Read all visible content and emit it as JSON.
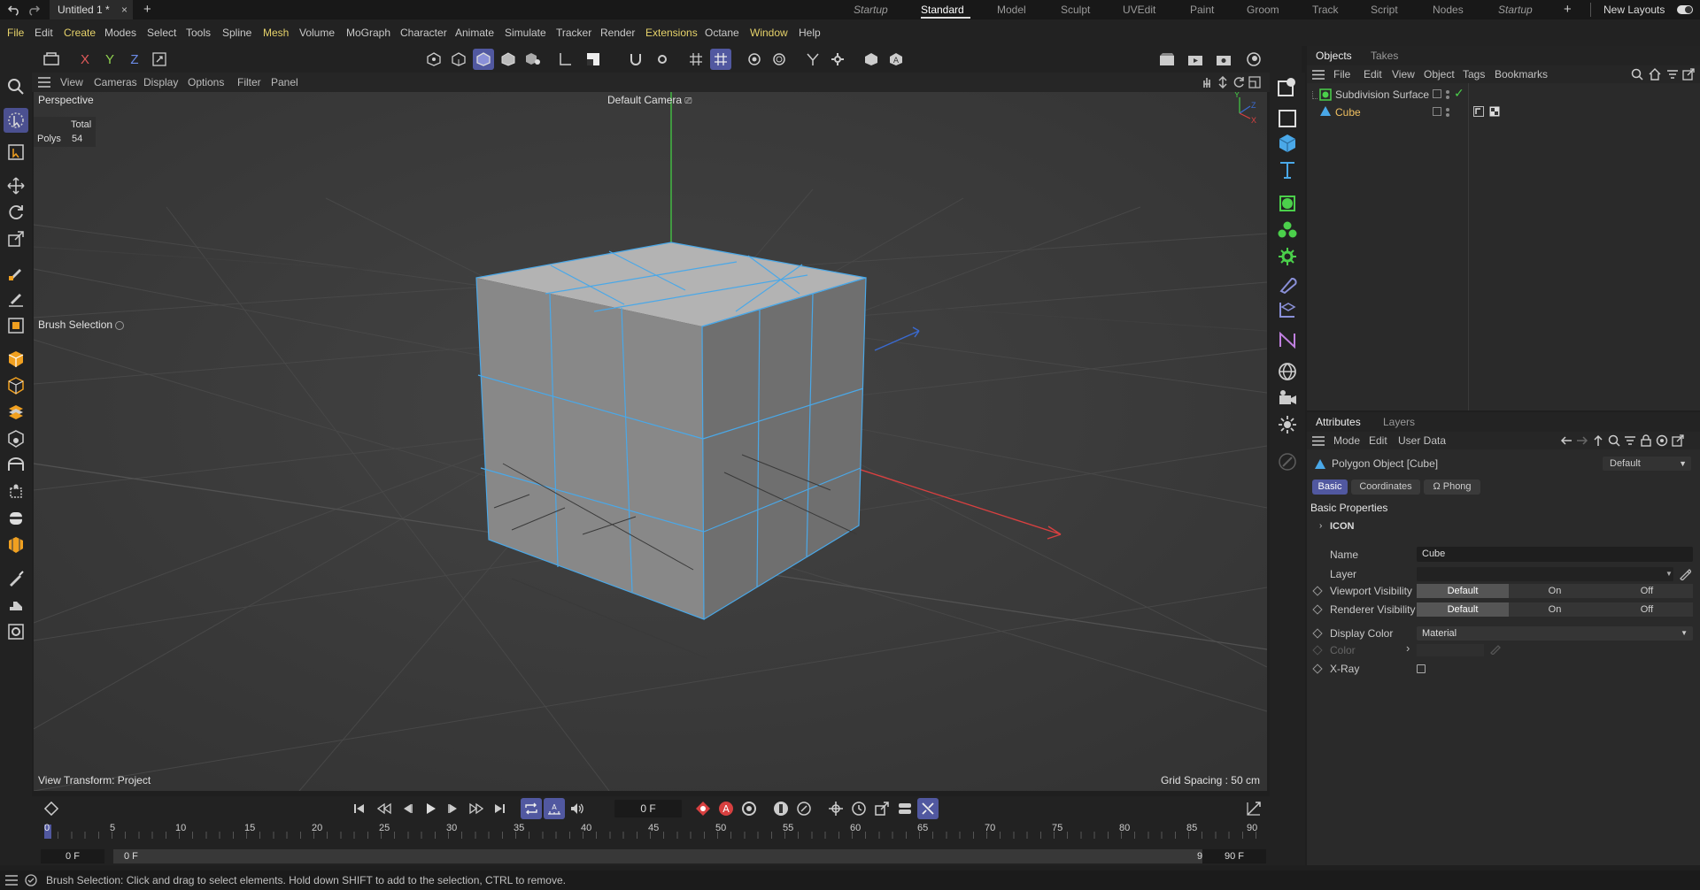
{
  "window": {
    "tab_title": "Untitled 1 *",
    "tab_close": "×",
    "new_tab": "+"
  },
  "layouts": {
    "items": [
      "Startup",
      "Standard",
      "Model",
      "Sculpt",
      "UVEdit",
      "Paint",
      "Groom",
      "Track",
      "Script",
      "Nodes",
      "Startup"
    ],
    "current": "Standard",
    "add": "+",
    "new_layouts": "New Layouts"
  },
  "menu": [
    "File",
    "Edit",
    "Create",
    "Modes",
    "Select",
    "Tools",
    "Spline",
    "Mesh",
    "Volume",
    "MoGraph",
    "Character",
    "Animate",
    "Simulate",
    "Tracker",
    "Render",
    "Extensions",
    "Octane",
    "Window",
    "Help"
  ],
  "axis_buttons": {
    "x": "X",
    "y": "Y",
    "z": "Z"
  },
  "viewport": {
    "menu": [
      "View",
      "Cameras",
      "Display",
      "Options",
      "Filter",
      "Panel"
    ],
    "projection": "Perspective",
    "camera": "Default Camera",
    "camera_icon": "⎚",
    "stats": {
      "header": "Total",
      "label": "Polys",
      "value": "54"
    },
    "tool_label": "Brush Selection",
    "view_transform": "View Transform: Project",
    "grid_spacing": "Grid Spacing : 50 cm",
    "axis_labels": {
      "y": "Y",
      "z": "Z",
      "x": "X"
    }
  },
  "objects_panel": {
    "tabs": [
      "Objects",
      "Takes"
    ],
    "menu": [
      "File",
      "Edit",
      "View",
      "Object",
      "Tags",
      "Bookmarks"
    ],
    "items": [
      {
        "name": "Subdivision Surface",
        "color": "#d9d9d9"
      },
      {
        "name": "Cube",
        "color": "#f0c060"
      }
    ],
    "check_mark": "✓"
  },
  "attributes_panel": {
    "tabs": [
      "Attributes",
      "Layers"
    ],
    "menu": [
      "Mode",
      "Edit",
      "User Data"
    ],
    "object_title": "Polygon Object [Cube]",
    "preset": "Default",
    "subtabs": [
      "Basic",
      "Coordinates",
      "Phong"
    ],
    "phong_symbol": "Ω",
    "section": "Basic Properties",
    "group": "ICON",
    "fields": {
      "name_label": "Name",
      "name_value": "Cube",
      "layer_label": "Layer",
      "viewport_visibility": "Viewport Visibility",
      "renderer_visibility": "Renderer Visibility",
      "options": [
        "Default",
        "On",
        "Off"
      ],
      "display_color": "Display Color",
      "display_color_value": "Material",
      "color_label": "Color",
      "xray_label": "X-Ray"
    }
  },
  "timeline": {
    "current_frame": "0 F",
    "ticks": [
      "0",
      "5",
      "10",
      "15",
      "20",
      "25",
      "30",
      "35",
      "40",
      "45",
      "50",
      "55",
      "60",
      "65",
      "70",
      "75",
      "80",
      "85",
      "90"
    ],
    "start": "0 F",
    "min": "0 F",
    "max": "90 F",
    "end": "90 F"
  },
  "status": {
    "message": "Brush Selection: Click and drag to select elements. Hold down SHIFT to add to the selection, CTRL to remove."
  },
  "colors": {
    "accent": "#5158a0",
    "highlight_text": "#e6d26a",
    "cube_edge": "#4aa8e8",
    "x_axis": "#d84040",
    "y_axis": "#44cc44",
    "z_axis": "#3a6ad0"
  }
}
